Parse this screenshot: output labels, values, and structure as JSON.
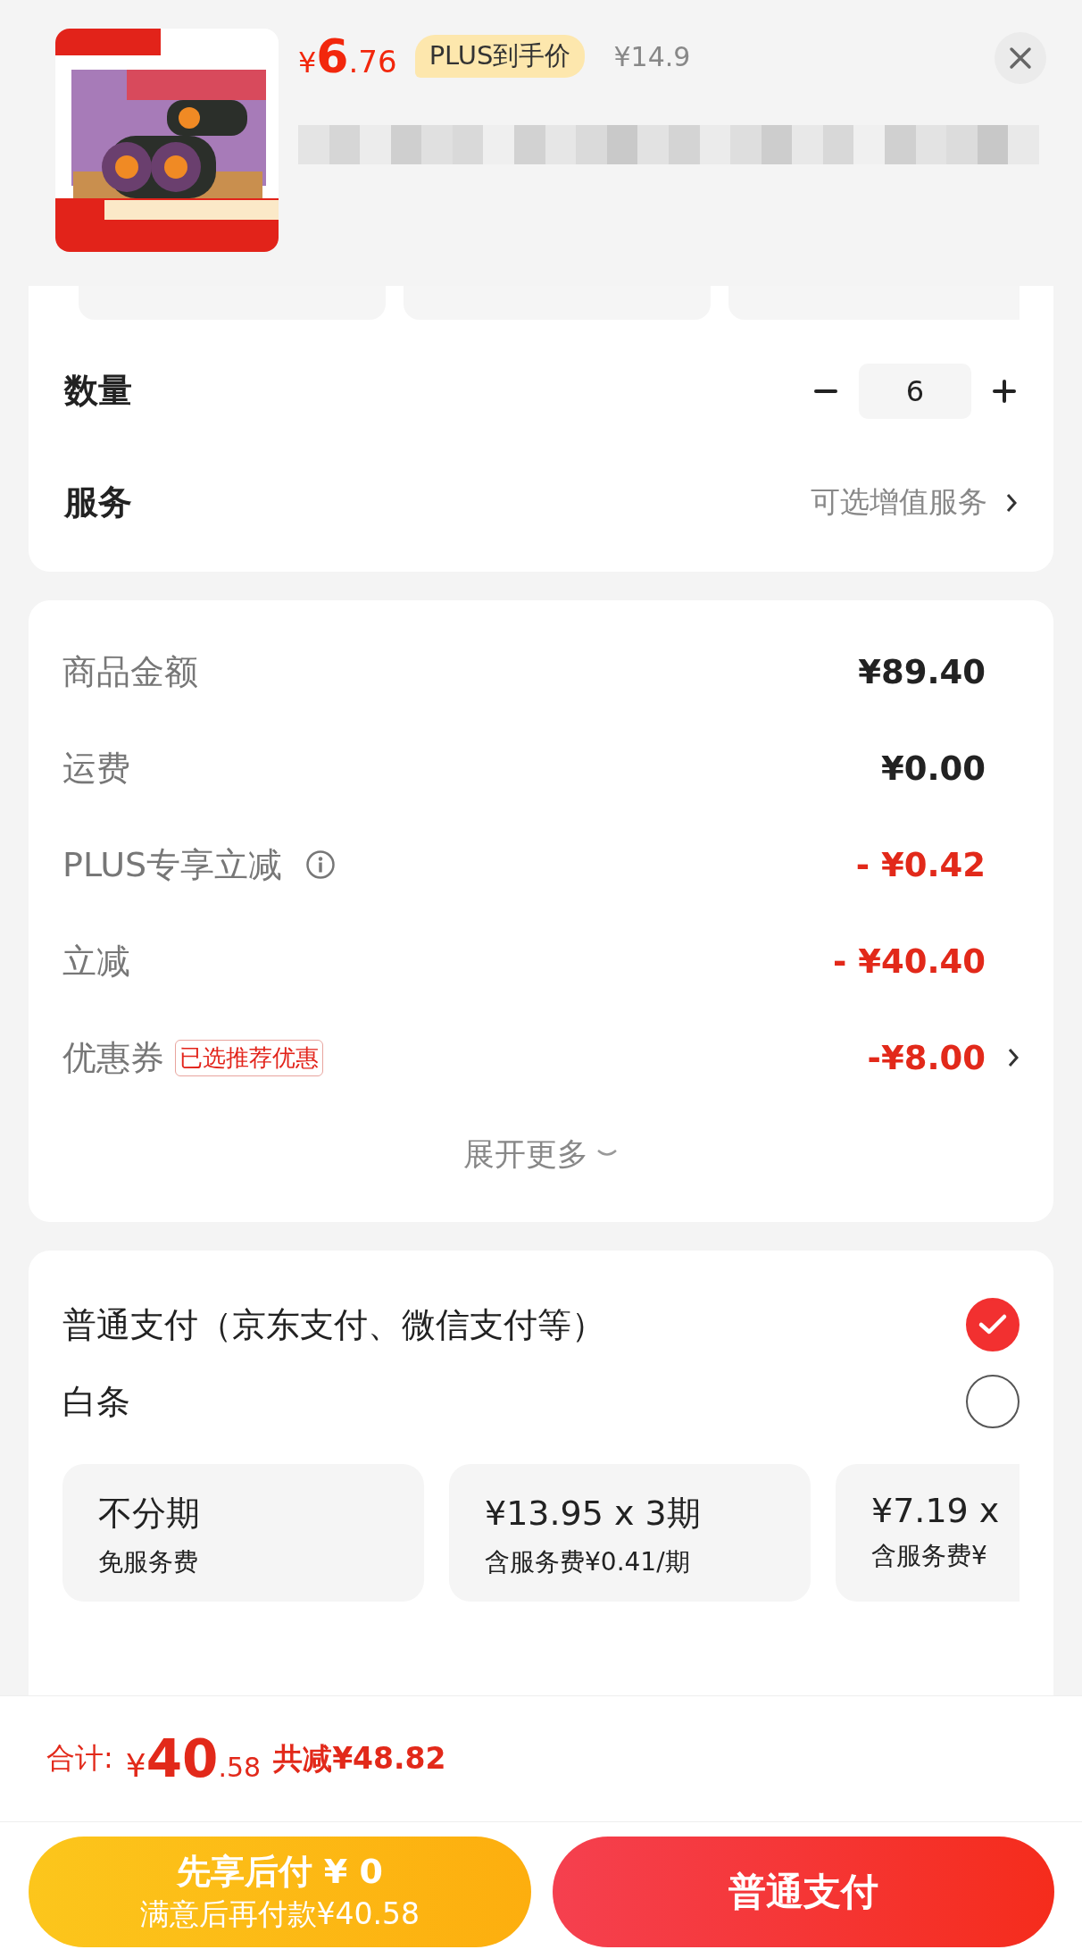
{
  "product": {
    "price": {
      "currency": "¥",
      "integer": "6",
      "decimal": ".76"
    },
    "price_tag": "PLUS到手价",
    "original_price": "¥14.9"
  },
  "quantity": {
    "label": "数量",
    "value": "6"
  },
  "service": {
    "label": "服务",
    "value": "可选增值服务"
  },
  "summary": [
    {
      "label": "商品金额",
      "amount": "¥89.40",
      "kind": "plain",
      "info": false,
      "arrow": false
    },
    {
      "label": "运费",
      "amount": "¥0.00",
      "kind": "plain",
      "info": false,
      "arrow": false
    },
    {
      "label": "PLUS专享立减",
      "amount": "- ¥0.42",
      "kind": "discount",
      "info": true,
      "arrow": false
    },
    {
      "label": "立减",
      "amount": "- ¥40.40",
      "kind": "discount",
      "info": false,
      "arrow": false
    },
    {
      "label": "优惠券",
      "tag": "已选推荐优惠",
      "amount": "-¥8.00",
      "kind": "discount",
      "info": false,
      "arrow": true
    }
  ],
  "expand": "展开更多",
  "payment_methods": [
    {
      "label": "普通支付（京东支付、微信支付等）",
      "selected": true
    },
    {
      "label": "白条",
      "selected": false
    }
  ],
  "installments": [
    {
      "title": "不分期",
      "subtitle": "免服务费"
    },
    {
      "title": "¥13.95 x 3期",
      "subtitle": "含服务费¥0.41/期"
    },
    {
      "title": "¥7.19 x",
      "subtitle": "含服务费¥"
    }
  ],
  "total": {
    "label": "合计:",
    "currency": "¥",
    "integer": "40",
    "decimal": ".58",
    "saved": "共减¥48.82"
  },
  "buttons": [
    {
      "kind": "later",
      "title": "先享后付 ¥ 0",
      "subtitle": "满意后再付款¥40.58"
    },
    {
      "kind": "primary",
      "title": "普通支付"
    }
  ]
}
